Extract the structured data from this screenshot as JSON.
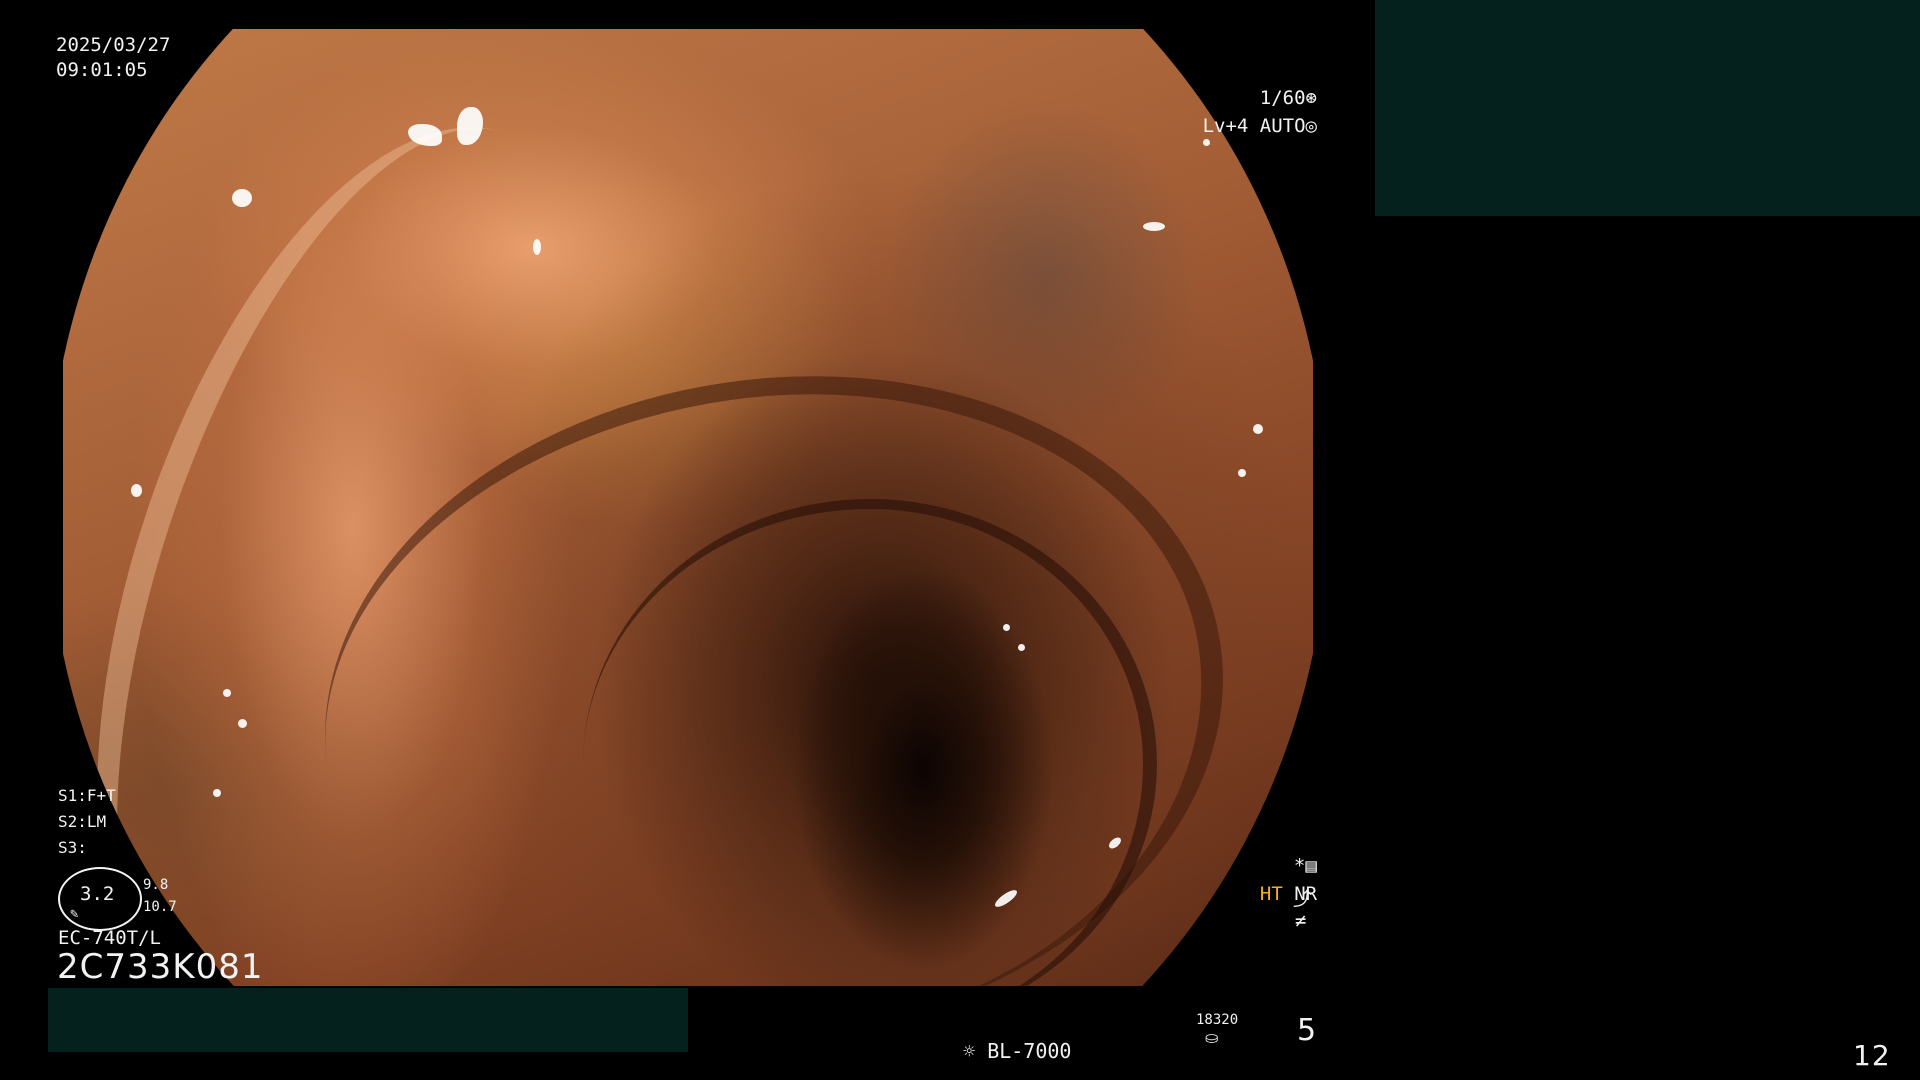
{
  "datetime": {
    "date": "2025/03/27",
    "time": "09:01:05"
  },
  "camera": {
    "shutter": "1/60",
    "level": "Lv+4",
    "mode": "AUTO"
  },
  "settings": {
    "s1": "S1:F+T",
    "s2": "S2:LM",
    "s3": "S3:"
  },
  "zoom": {
    "value": "3.2",
    "value_a": "9.8",
    "value_b": "10.7"
  },
  "scope": {
    "model": "EC-740T/L",
    "serial": "2C733K081"
  },
  "status": {
    "marker": "*",
    "ht": "HT",
    "nr": "NR"
  },
  "footer": {
    "light_source": "BL-7000",
    "counter": "18320",
    "channel": "5",
    "page_number": "12"
  },
  "colors": {
    "panel": "#04211e",
    "ht_accent": "#f1b020",
    "overlay_text": "#f2f2f2"
  }
}
